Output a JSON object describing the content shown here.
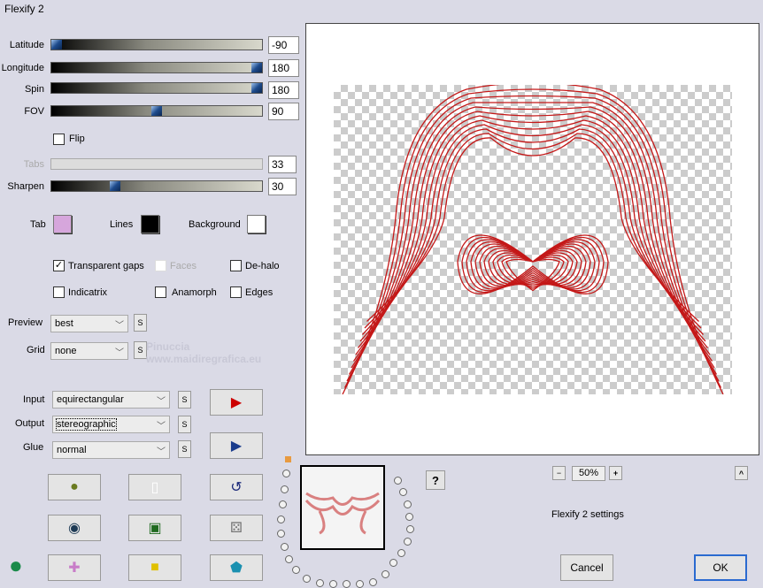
{
  "window": {
    "title": "Flexify 2"
  },
  "sliders": [
    {
      "label": "Latitude",
      "value": "-90",
      "fraction": 0.0
    },
    {
      "label": "Longitude",
      "value": "180",
      "fraction": 1.0
    },
    {
      "label": "Spin",
      "value": "180",
      "fraction": 1.0
    },
    {
      "label": "FOV",
      "value": "90",
      "fraction": 0.5
    }
  ],
  "flip": {
    "label": "Flip",
    "checked": false
  },
  "tabs": {
    "label": "Tabs",
    "value": "33"
  },
  "sharpen": {
    "label": "Sharpen",
    "value": "30",
    "fraction": 0.3
  },
  "colors": {
    "tab_label": "Tab",
    "tab": "#d6a6dc",
    "lines_label": "Lines",
    "lines": "#000000",
    "background_label": "Background",
    "background": "#ffffff"
  },
  "checks": {
    "transparent_gaps": "Transparent gaps",
    "faces": "Faces",
    "dehalo": "De-halo",
    "indicatrix": "Indicatrix",
    "anamorph": "Anamorph",
    "edges": "Edges"
  },
  "selects": {
    "preview_label": "Preview",
    "preview": "best",
    "grid_label": "Grid",
    "grid": "none",
    "input_label": "Input",
    "input": "equirectangular",
    "output_label": "Output",
    "output": "stereographic",
    "glue_label": "Glue",
    "glue": "normal",
    "s": "S"
  },
  "watermark": {
    "name": "Pinuccia",
    "url": "www.maidiregrafica.eu"
  },
  "zoom": {
    "minus": "−",
    "value": "50%",
    "plus": "+",
    "up": "^"
  },
  "help": "?",
  "settings_text": "Flexify 2 settings",
  "buttons": {
    "cancel": "Cancel",
    "ok": "OK"
  }
}
